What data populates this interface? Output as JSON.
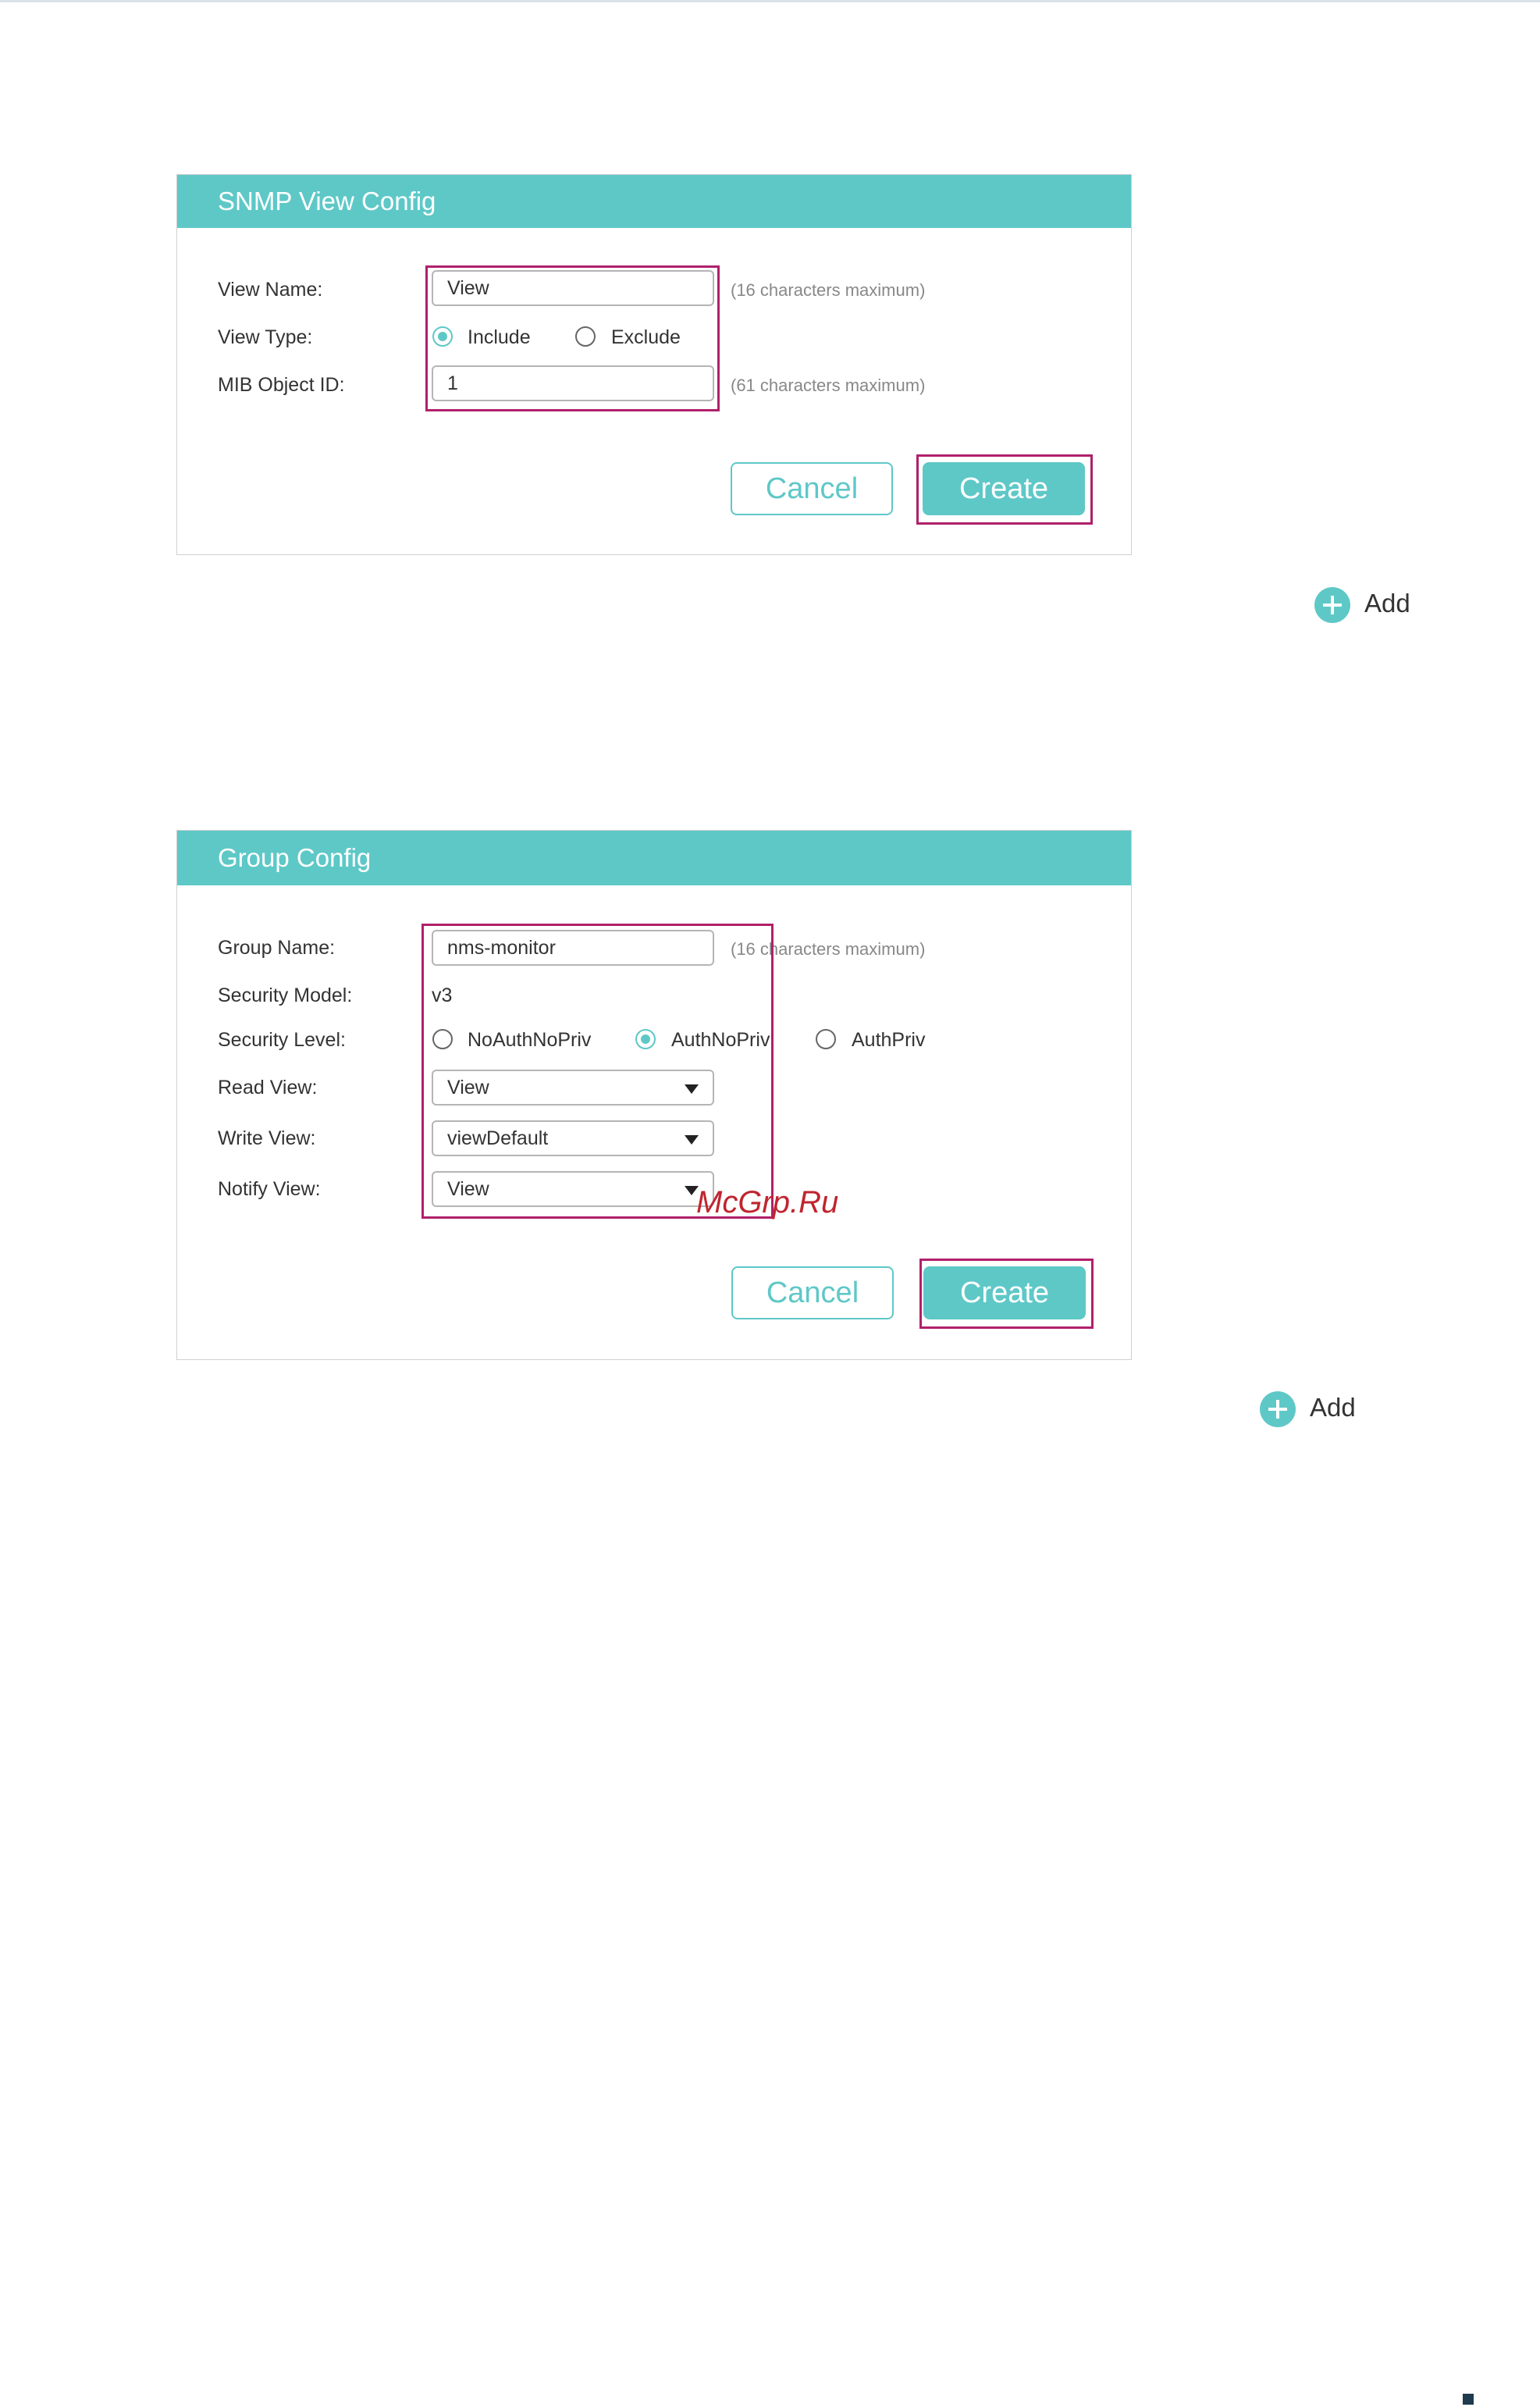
{
  "snmp_view": {
    "title": "SNMP View Config",
    "view_name_label": "View Name:",
    "view_name_value": "View",
    "view_name_hint": "(16 characters maximum)",
    "view_type_label": "View Type:",
    "view_type_options": [
      "Include",
      "Exclude"
    ],
    "view_type_selected": "Include",
    "mib_object_id_label": "MIB Object ID:",
    "mib_object_id_value": "1",
    "mib_object_id_hint": "(61 characters maximum)",
    "cancel_label": "Cancel",
    "create_label": "Create"
  },
  "add_1": {
    "label": "Add",
    "icon": "plus-circle-icon"
  },
  "group": {
    "title": "Group Config",
    "group_name_label": "Group Name:",
    "group_name_value": "nms-monitor",
    "group_name_hint": "(16 characters maximum)",
    "security_model_label": "Security Model:",
    "security_model_value": "v3",
    "security_level_label": "Security Level:",
    "security_level_options": [
      "NoAuthNoPriv",
      "AuthNoPriv",
      "AuthPriv"
    ],
    "security_level_selected": "AuthNoPriv",
    "read_view_label": "Read View:",
    "read_view_value": "View",
    "write_view_label": "Write View:",
    "write_view_value": "viewDefault",
    "notify_view_label": "Notify View:",
    "notify_view_value": "View",
    "cancel_label": "Cancel",
    "create_label": "Create"
  },
  "add_2": {
    "label": "Add",
    "icon": "plus-circle-icon"
  },
  "watermark": "McGrp.Ru",
  "colors": {
    "accent": "#5ec8c7",
    "highlight": "#b0206b",
    "watermark": "#c0252f"
  }
}
